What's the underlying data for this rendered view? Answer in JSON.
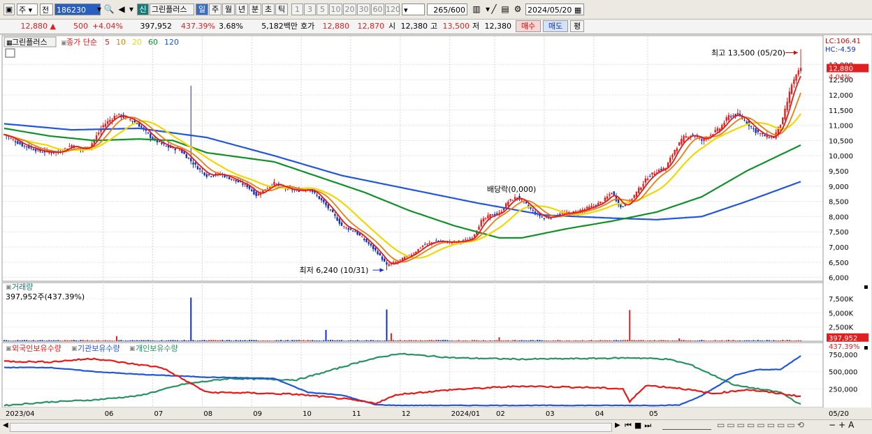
{
  "toolbar": {
    "market": "주",
    "kind": "전",
    "code": "186230",
    "tag": "신",
    "name": "그린플러스",
    "periods": [
      "일",
      "주",
      "월",
      "년",
      "분",
      "초",
      "틱"
    ],
    "active_period": "일",
    "minutes": [
      "1",
      "3",
      "5",
      "10",
      "20",
      "30",
      "60",
      "120"
    ],
    "count": "265",
    "count_total": "/600",
    "date": "2024/05/20"
  },
  "quote": {
    "price": "12,880",
    "arrow": "▲",
    "change": "500",
    "change_pct": "+4.04%",
    "volume": "397,952",
    "volume_ratio": "437.39%",
    "turnover": "3.68%",
    "amount": "5,182백만",
    "hoga_label": "호가",
    "hoga_ask": "12,880",
    "hoga_bid": "12,870",
    "open_label": "시",
    "open": "12,380",
    "high_label": "고",
    "high": "13,500",
    "low_label": "저",
    "low": "12,380",
    "buy": "매수",
    "sell": "매도",
    "avg": "평"
  },
  "colors": {
    "up": "#e02020",
    "down": "#1030c0",
    "ma5": "#e81818",
    "ma10": "#e87d10",
    "ma20": "#f0d800",
    "ma60": "#11902a",
    "ma120": "#2255dd",
    "foreign": "#e81818",
    "inst": "#2255dd",
    "indiv": "#279360"
  },
  "chart_data": {
    "type": "stock",
    "x_tick_labels": [
      "2023/04",
      "06",
      "07",
      "08",
      "09",
      "10",
      "11",
      "12",
      "2024/01",
      "02",
      "03",
      "04",
      "05",
      "05/20"
    ],
    "price_panel": {
      "legend_name": "그린플러스",
      "legend_prefix": "종가 단순",
      "ma_periods": [
        "5",
        "10",
        "20",
        "60",
        "120"
      ],
      "y_ticks": [
        6000,
        6500,
        7000,
        7500,
        8000,
        8500,
        9000,
        9500,
        10000,
        10500,
        11000,
        11500,
        12000,
        12500,
        13000
      ],
      "ylim": [
        5900,
        13650
      ],
      "lc": "LC:106.41",
      "hc": "HC:-4.59",
      "current_price": 12880,
      "current_label": "12,880",
      "current_pct": "4.04%",
      "high_label": "최고 13,500 (05/20)",
      "low_label": "최저 6,240 (10/31)",
      "dividend_label": "배당락(0,000)",
      "close_anchors": [
        [
          0,
          10700
        ],
        [
          8,
          10350
        ],
        [
          16,
          10150
        ],
        [
          24,
          10100
        ],
        [
          30,
          10350
        ],
        [
          34,
          10200
        ],
        [
          38,
          10300
        ],
        [
          44,
          11000
        ],
        [
          50,
          11350
        ],
        [
          56,
          11200
        ],
        [
          60,
          11000
        ],
        [
          66,
          10550
        ],
        [
          72,
          10300
        ],
        [
          78,
          10200
        ],
        [
          82,
          9900
        ],
        [
          86,
          9600
        ],
        [
          90,
          9350
        ],
        [
          96,
          9400
        ],
        [
          102,
          9200
        ],
        [
          108,
          9000
        ],
        [
          112,
          8700
        ],
        [
          116,
          8900
        ],
        [
          120,
          9100
        ],
        [
          124,
          8950
        ],
        [
          130,
          8850
        ],
        [
          136,
          8900
        ],
        [
          142,
          8450
        ],
        [
          146,
          8100
        ],
        [
          150,
          7700
        ],
        [
          156,
          7500
        ],
        [
          162,
          7100
        ],
        [
          166,
          6800
        ],
        [
          168,
          6600
        ],
        [
          170,
          6400
        ],
        [
          174,
          6500
        ],
        [
          178,
          6650
        ],
        [
          182,
          6800
        ],
        [
          186,
          7050
        ],
        [
          192,
          7200
        ],
        [
          198,
          7150
        ],
        [
          204,
          7200
        ],
        [
          208,
          7300
        ],
        [
          212,
          7850
        ],
        [
          216,
          8050
        ],
        [
          220,
          8100
        ],
        [
          224,
          8500
        ],
        [
          228,
          8650
        ],
        [
          232,
          8400
        ],
        [
          236,
          8100
        ],
        [
          240,
          7950
        ],
        [
          244,
          8000
        ],
        [
          248,
          8100
        ],
        [
          254,
          8150
        ],
        [
          258,
          8250
        ],
        [
          262,
          8350
        ],
        [
          266,
          8500
        ],
        [
          270,
          8800
        ],
        [
          274,
          8300
        ],
        [
          278,
          8500
        ],
        [
          282,
          8900
        ],
        [
          286,
          9300
        ],
        [
          290,
          9500
        ],
        [
          294,
          9600
        ],
        [
          298,
          10200
        ],
        [
          302,
          10600
        ],
        [
          306,
          10700
        ],
        [
          310,
          10500
        ],
        [
          314,
          10700
        ],
        [
          318,
          10900
        ],
        [
          322,
          11300
        ],
        [
          326,
          11350
        ],
        [
          330,
          11100
        ],
        [
          334,
          10800
        ],
        [
          338,
          10650
        ],
        [
          342,
          10600
        ],
        [
          346,
          11200
        ],
        [
          350,
          12350
        ],
        [
          354,
          12880
        ]
      ],
      "ma120_anchors": [
        [
          0,
          11050
        ],
        [
          30,
          10850
        ],
        [
          60,
          10900
        ],
        [
          90,
          10600
        ],
        [
          120,
          10000
        ],
        [
          150,
          9350
        ],
        [
          180,
          8900
        ],
        [
          210,
          8450
        ],
        [
          240,
          8050
        ],
        [
          270,
          7950
        ],
        [
          290,
          7900
        ],
        [
          310,
          8000
        ],
        [
          330,
          8500
        ],
        [
          354,
          9150
        ]
      ],
      "ma60_anchors": [
        [
          0,
          10900
        ],
        [
          20,
          10650
        ],
        [
          40,
          10500
        ],
        [
          60,
          10550
        ],
        [
          75,
          10500
        ],
        [
          90,
          10100
        ],
        [
          120,
          9800
        ],
        [
          140,
          9300
        ],
        [
          160,
          8800
        ],
        [
          180,
          8200
        ],
        [
          200,
          7700
        ],
        [
          220,
          7300
        ],
        [
          230,
          7300
        ],
        [
          250,
          7600
        ],
        [
          270,
          7850
        ],
        [
          290,
          8150
        ],
        [
          310,
          8650
        ],
        [
          330,
          9500
        ],
        [
          354,
          10350
        ]
      ],
      "highlights": {
        "high_index": 354,
        "high_value": 13500,
        "low_index": 170,
        "low_value": 6240,
        "volume_spike_index": 83,
        "spike_high_value": 12300,
        "dividend_index": 222
      }
    },
    "volume_panel": {
      "title": "거래량",
      "summary": "397,952주(437.39%)",
      "y_ticks": [
        2500,
        5000,
        7500
      ],
      "y_tick_labels": [
        "2,500K",
        "5,000K",
        "7,500K"
      ],
      "current_label": "397,952",
      "ratio_label": "437.39%",
      "spikes": [
        [
          83,
          7700
        ],
        [
          170,
          5600
        ],
        [
          278,
          5500
        ],
        [
          143,
          2000
        ],
        [
          50,
          900
        ],
        [
          172,
          1400
        ],
        [
          220,
          700
        ],
        [
          300,
          500
        ]
      ]
    },
    "holdings_panel": {
      "series_names": [
        "외국인보유수량",
        "기관보유수량",
        "개인보유수량"
      ],
      "y_ticks": [
        250000,
        500000,
        750000
      ],
      "y_tick_labels": [
        "250,000",
        "500,000",
        "750,000"
      ],
      "ylim": [
        0,
        850000
      ],
      "foreign_anchors": [
        [
          0,
          650000
        ],
        [
          20,
          640000
        ],
        [
          40,
          690000
        ],
        [
          55,
          620000
        ],
        [
          70,
          560000
        ],
        [
          80,
          380000
        ],
        [
          90,
          200000
        ],
        [
          110,
          190000
        ],
        [
          130,
          170000
        ],
        [
          150,
          110000
        ],
        [
          165,
          40000
        ],
        [
          175,
          170000
        ],
        [
          200,
          240000
        ],
        [
          230,
          290000
        ],
        [
          260,
          270000
        ],
        [
          275,
          250000
        ],
        [
          278,
          60000
        ],
        [
          285,
          300000
        ],
        [
          300,
          260000
        ],
        [
          315,
          180000
        ],
        [
          330,
          240000
        ],
        [
          345,
          180000
        ],
        [
          354,
          140000
        ]
      ],
      "inst_anchors": [
        [
          0,
          560000
        ],
        [
          20,
          560000
        ],
        [
          40,
          500000
        ],
        [
          60,
          460000
        ],
        [
          90,
          420000
        ],
        [
          120,
          400000
        ],
        [
          135,
          200000
        ],
        [
          150,
          160000
        ],
        [
          165,
          20000
        ],
        [
          175,
          10000
        ],
        [
          230,
          10000
        ],
        [
          290,
          10000
        ],
        [
          300,
          15000
        ],
        [
          310,
          150000
        ],
        [
          325,
          450000
        ],
        [
          335,
          530000
        ],
        [
          345,
          530000
        ],
        [
          354,
          730000
        ]
      ],
      "indiv_anchors": [
        [
          0,
          10000
        ],
        [
          20,
          60000
        ],
        [
          40,
          90000
        ],
        [
          60,
          150000
        ],
        [
          80,
          320000
        ],
        [
          100,
          400000
        ],
        [
          130,
          380000
        ],
        [
          140,
          470000
        ],
        [
          160,
          660000
        ],
        [
          175,
          760000
        ],
        [
          200,
          700000
        ],
        [
          230,
          680000
        ],
        [
          260,
          690000
        ],
        [
          280,
          700000
        ],
        [
          295,
          680000
        ],
        [
          305,
          600000
        ],
        [
          315,
          450000
        ],
        [
          325,
          300000
        ],
        [
          335,
          250000
        ],
        [
          345,
          200000
        ],
        [
          354,
          20000
        ]
      ]
    }
  },
  "nav": {
    "left": "◀",
    "right": "▶"
  }
}
